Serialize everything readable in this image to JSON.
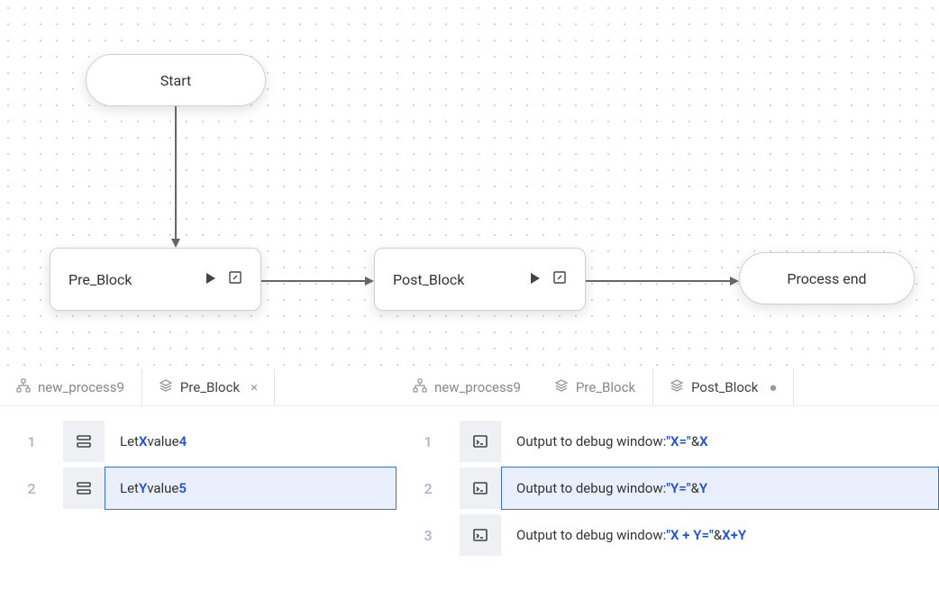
{
  "flow": {
    "start": "Start",
    "pre_block": "Pre_Block",
    "post_block": "Post_Block",
    "end": "Process end"
  },
  "left_panel": {
    "tabs": [
      {
        "icon": "tree",
        "label": "new_process9",
        "active": false,
        "close": null
      },
      {
        "icon": "stack",
        "label": "Pre_Block",
        "active": true,
        "close": "×"
      }
    ],
    "rows": [
      {
        "n": "1",
        "let": "Let ",
        "var": "X",
        "mid": " value ",
        "val": "4",
        "selected": false
      },
      {
        "n": "2",
        "let": "Let ",
        "var": "Y",
        "mid": " value ",
        "val": "5",
        "selected": true
      }
    ]
  },
  "right_panel": {
    "tabs": [
      {
        "icon": "tree",
        "label": "new_process9",
        "active": false,
        "close": null
      },
      {
        "icon": "stack",
        "label": "Pre_Block",
        "active": false,
        "close": null
      },
      {
        "icon": "stack",
        "label": "Post_Block",
        "active": true,
        "close": "●"
      }
    ],
    "rows": [
      {
        "n": "1",
        "pre": "Output to debug window: ",
        "str": "\"X=\"",
        "amp": "& ",
        "expr": "X",
        "selected": false
      },
      {
        "n": "2",
        "pre": "Output to debug window: ",
        "str": "\"Y=\"",
        "amp": "& ",
        "expr": "Y",
        "selected": true
      },
      {
        "n": "3",
        "pre": "Output to debug window: ",
        "str": "\"X + Y=\"",
        "amp": "& ",
        "expr": "X+Y",
        "selected": false
      }
    ]
  }
}
